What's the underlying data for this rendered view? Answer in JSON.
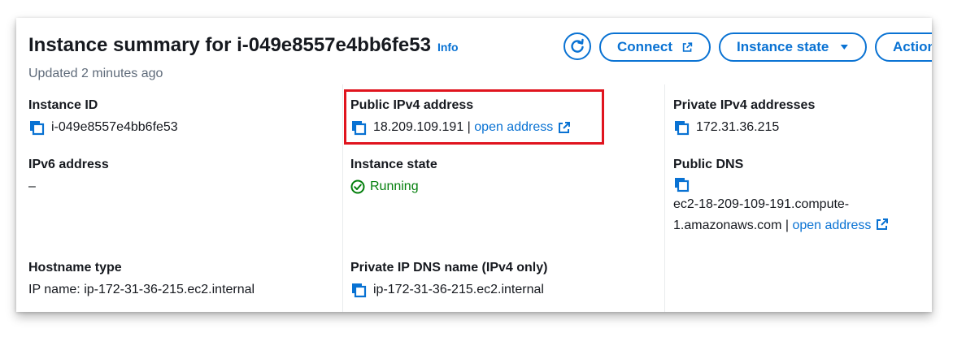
{
  "header": {
    "title": "Instance summary for i-049e8557e4bb6fe53",
    "info": "Info",
    "updated": "Updated 2 minutes ago"
  },
  "toolbar": {
    "refresh_icon": "refresh-icon",
    "connect_label": "Connect",
    "instance_state_label": "Instance state",
    "actions_label": "Action"
  },
  "fields": {
    "instance_id": {
      "label": "Instance ID",
      "value": "i-049e8557e4bb6fe53"
    },
    "public_ipv4": {
      "label": "Public IPv4 address",
      "value": "18.209.109.191",
      "separator": " | ",
      "link": "open address"
    },
    "private_ipv4": {
      "label": "Private IPv4 addresses",
      "value": "172.31.36.215"
    },
    "ipv6": {
      "label": "IPv6 address",
      "value": "–"
    },
    "instance_state": {
      "label": "Instance state",
      "value": "Running"
    },
    "public_dns": {
      "label": "Public DNS",
      "value_line1": "ec2-18-209-109-191.compute-",
      "value_line2": "1.amazonaws.com",
      "separator": " | ",
      "link": "open address"
    },
    "hostname_type": {
      "label": "Hostname type",
      "value": "IP name: ip-172-31-36-215.ec2.internal"
    },
    "private_ip_dns": {
      "label": "Private IP DNS name (IPv4 only)",
      "value": "ip-172-31-36-215.ec2.internal"
    }
  },
  "colors": {
    "link": "#0972d3",
    "success": "#037f0c",
    "highlight": "#e0141e",
    "text": "#16191f",
    "muted": "#5f6b7a"
  }
}
